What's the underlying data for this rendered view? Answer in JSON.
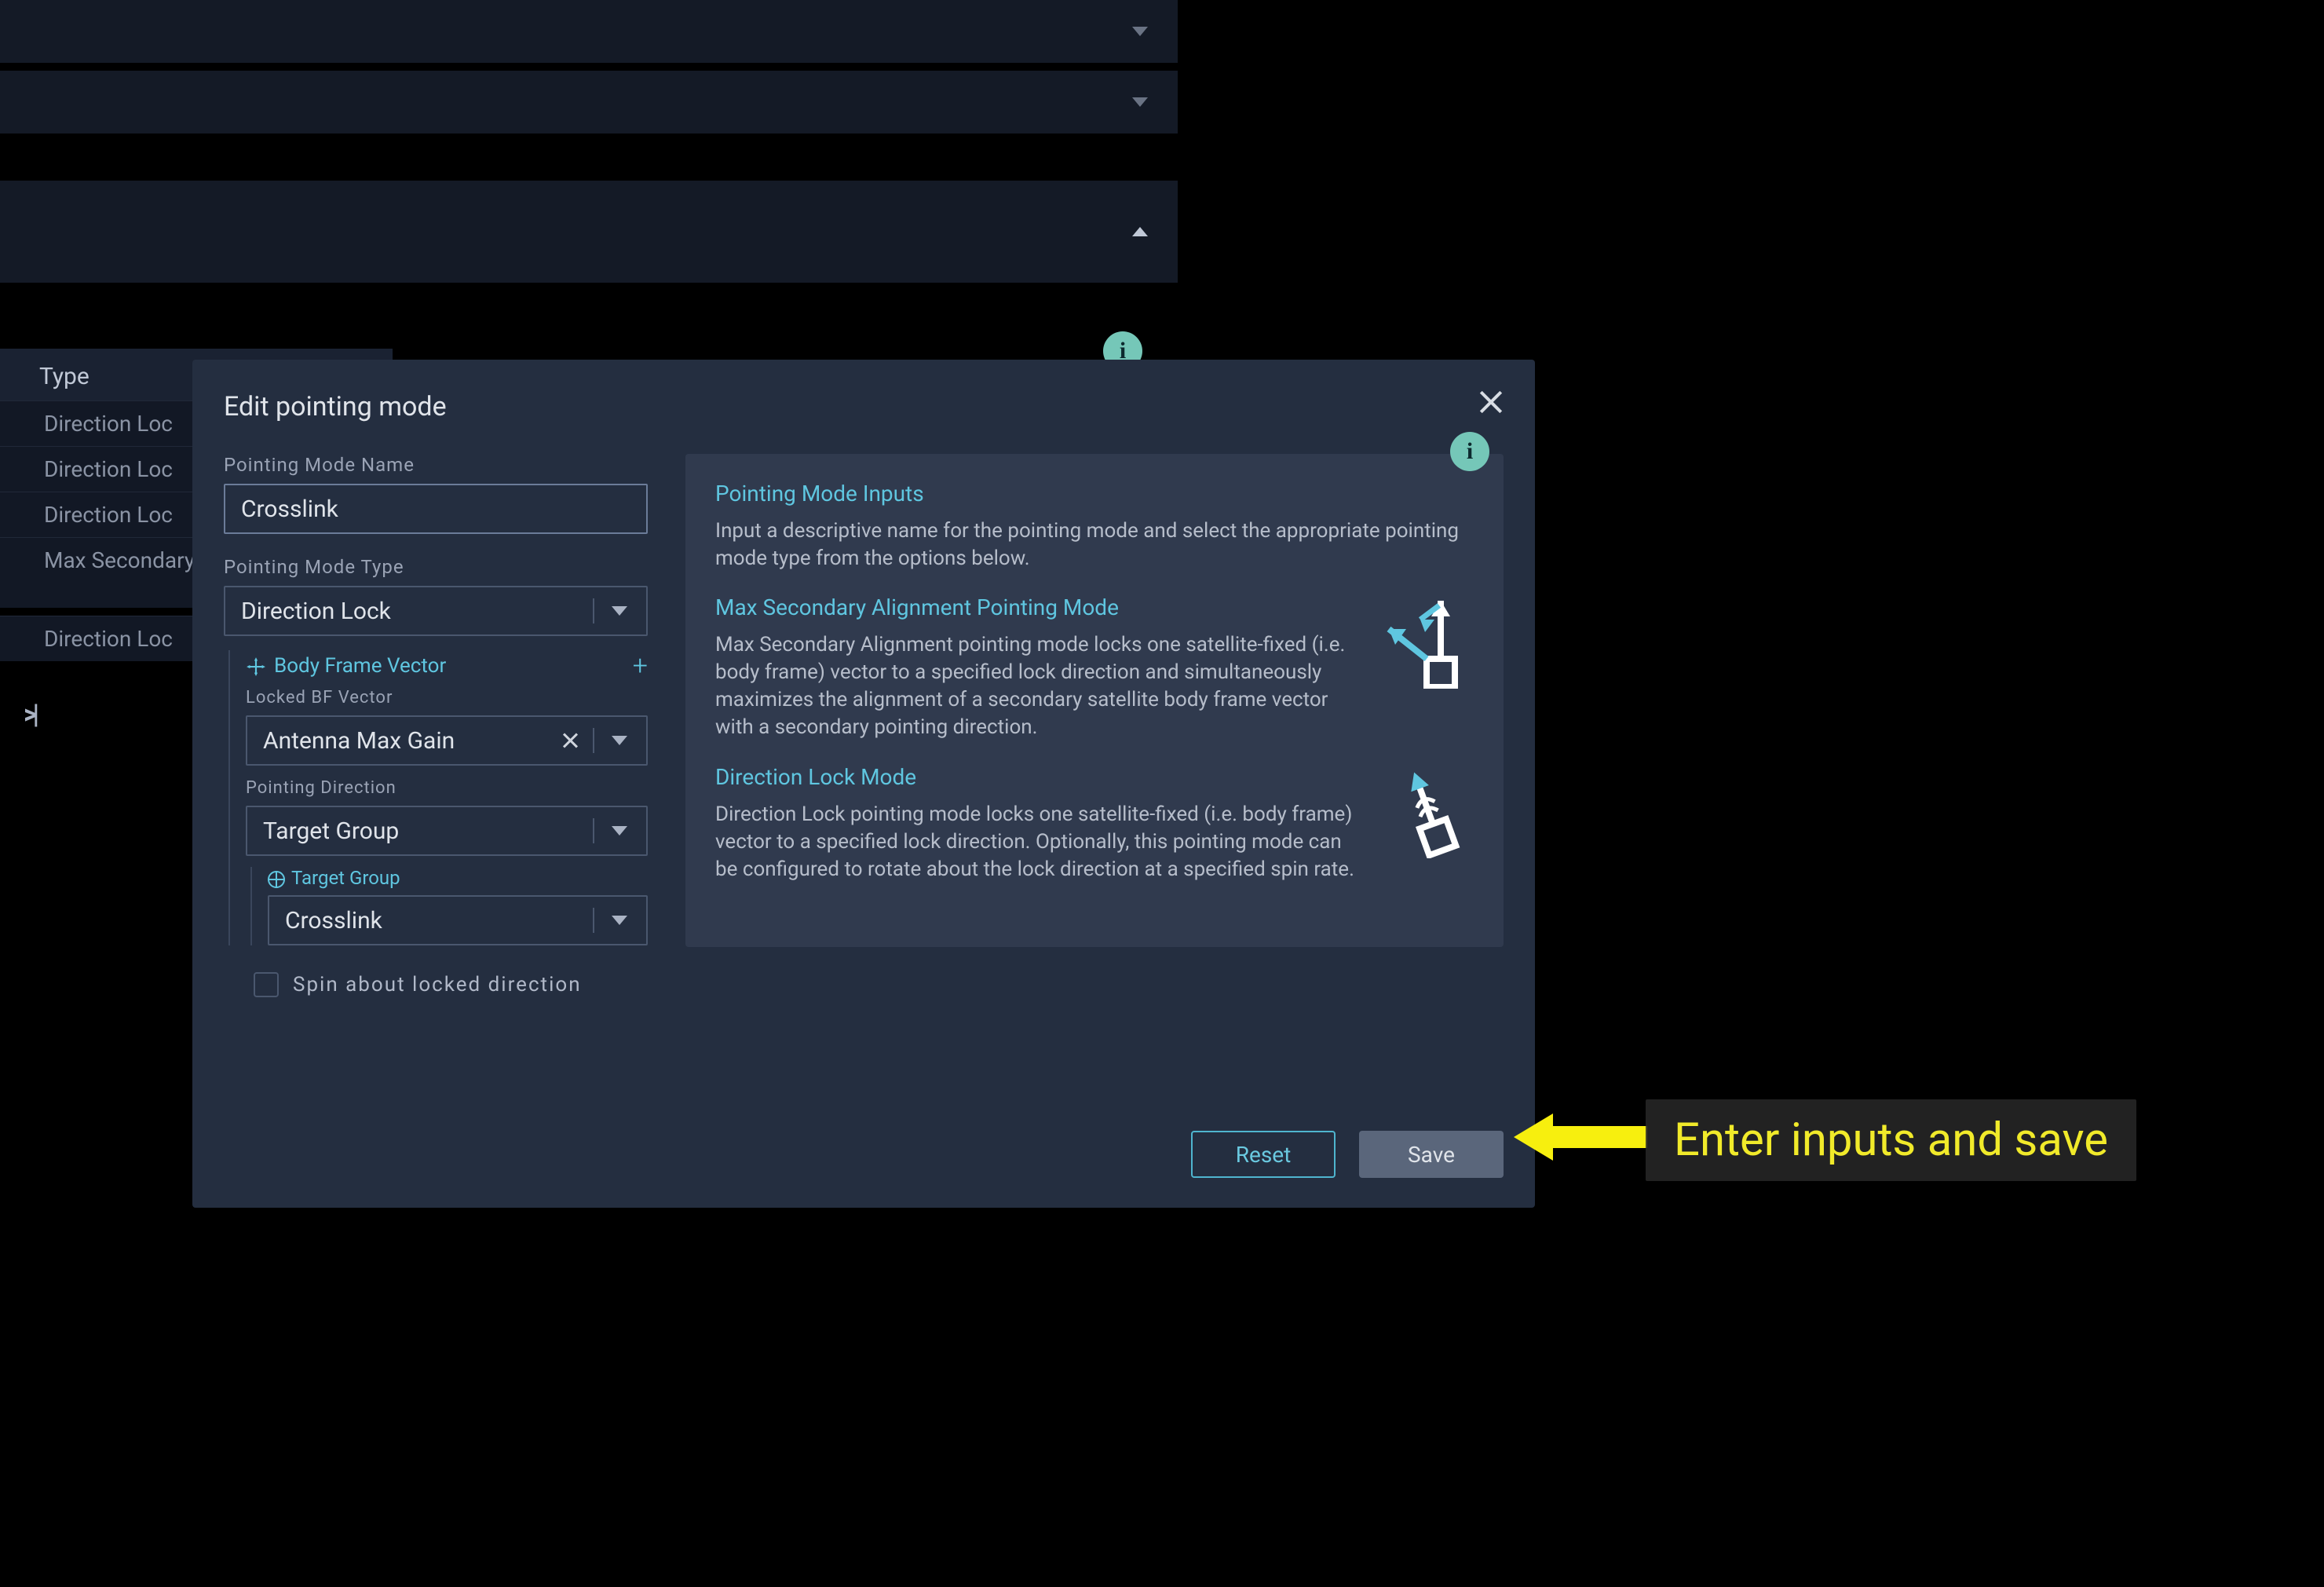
{
  "bg": {
    "header": "Type",
    "rows": [
      "Direction Loc",
      "Direction Loc",
      "Direction Loc",
      "Max Secondary Alignment",
      "Direction Loc"
    ],
    "collapse_glyph": ">|"
  },
  "modal": {
    "title": "Edit pointing mode",
    "name_label": "Pointing Mode Name",
    "name_value": "Crosslink",
    "type_label": "Pointing Mode Type",
    "type_value": "Direction Lock",
    "bfv_title": "Body Frame Vector",
    "locked_bf_label": "Locked BF Vector",
    "locked_bf_value": "Antenna Max Gain",
    "pointing_dir_label": "Pointing Direction",
    "pointing_dir_value": "Target Group",
    "target_group_label": "Target Group",
    "target_group_value": "Crosslink",
    "spin_label": "Spin about locked direction",
    "reset": "Reset",
    "save": "Save"
  },
  "info": {
    "h1": "Pointing Mode Inputs",
    "p1": "Input a descriptive name for the pointing mode and select the appropriate pointing mode type from the options below.",
    "h2": "Max Secondary Alignment Pointing Mode",
    "p2": "Max Secondary Alignment pointing mode locks one satellite-fixed (i.e. body frame) vector to a specified lock direction and simultaneously maximizes the alignment of a secondary satellite body frame vector with a secondary pointing direction.",
    "h3": "Direction Lock Mode",
    "p3": "Direction Lock pointing mode locks one satellite-fixed (i.e. body frame) vector to a specified lock direction. Optionally, this pointing mode can be configured to rotate about the lock direction at a specified spin rate."
  },
  "annotation": {
    "text": "Enter inputs and save"
  }
}
